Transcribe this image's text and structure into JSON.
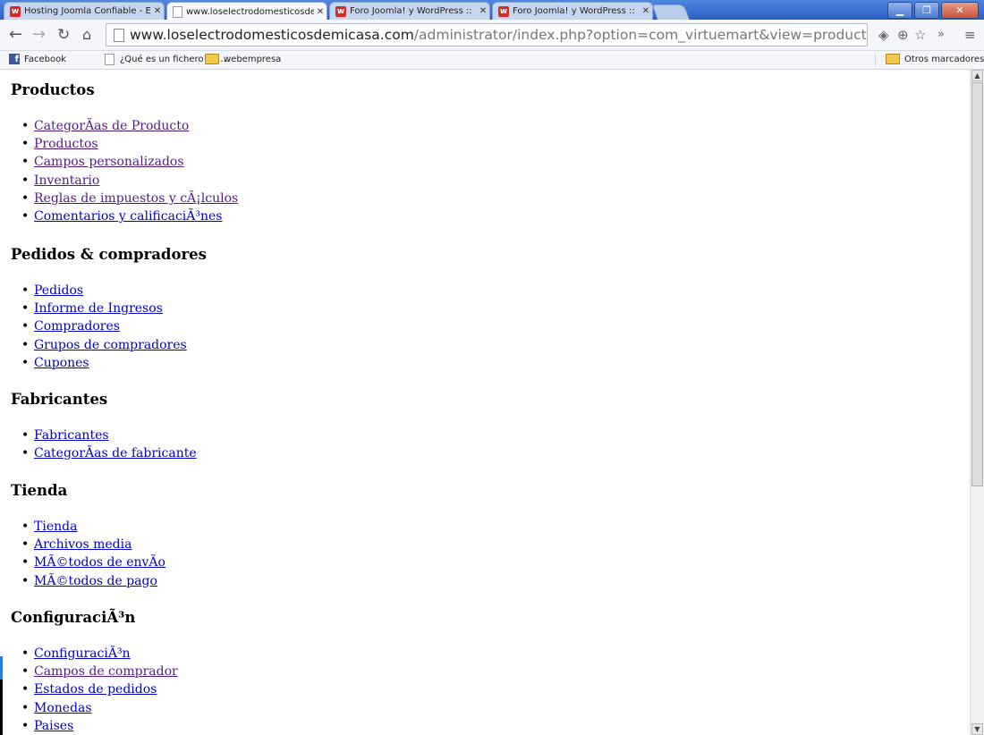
{
  "browser": {
    "tabs": [
      {
        "title": "Hosting Joomla Confiable - E",
        "icon": "webempresa-icon",
        "active": false
      },
      {
        "title": "www.loselectrodomesticosde",
        "icon": "page-icon",
        "active": true
      },
      {
        "title": "Foro Joomla! y WordPress ::",
        "icon": "webempresa-icon",
        "active": false
      },
      {
        "title": "Foro Joomla! y WordPress ::",
        "icon": "webempresa-icon",
        "active": false
      }
    ],
    "url_domain": "www.loselectrodomesticosdemicasa.com",
    "url_path": "/administrator/index.php?option=com_virtuemart&view=product",
    "bookmarks": [
      {
        "label": "Facebook",
        "icon": "facebook-icon"
      },
      {
        "label": "¿Qué es un fichero de ...",
        "icon": "page-icon"
      },
      {
        "label": "webempresa",
        "icon": "folder-icon"
      }
    ],
    "other_bookmarks": "Otros marcadores"
  },
  "sections": [
    {
      "title": "Productos",
      "links": [
        {
          "label": "CategorÃas de Producto",
          "visited": true
        },
        {
          "label": "Productos",
          "visited": true
        },
        {
          "label": "Campos personalizados",
          "visited": true
        },
        {
          "label": "Inventario",
          "visited": true
        },
        {
          "label": "Reglas de impuestos y cÃ¡lculos",
          "visited": true
        },
        {
          "label": "Comentarios y calificaciÃ³nes",
          "visited": false
        }
      ]
    },
    {
      "title": "Pedidos & compradores",
      "links": [
        {
          "label": "Pedidos",
          "visited": false
        },
        {
          "label": "Informe de Ingresos",
          "visited": false
        },
        {
          "label": "Compradores",
          "visited": false
        },
        {
          "label": "Grupos de compradores",
          "visited": false
        },
        {
          "label": "Cupones",
          "visited": false
        }
      ]
    },
    {
      "title": "Fabricantes",
      "links": [
        {
          "label": "Fabricantes",
          "visited": false
        },
        {
          "label": "CategorÃas de fabricante",
          "visited": false
        }
      ]
    },
    {
      "title": "Tienda",
      "links": [
        {
          "label": "Tienda",
          "visited": false
        },
        {
          "label": "Archivos media",
          "visited": false
        },
        {
          "label": "MÃ©todos de envÃo",
          "visited": false
        },
        {
          "label": "MÃ©todos de pago",
          "visited": false
        }
      ]
    },
    {
      "title": "ConfiguraciÃ³n",
      "links": [
        {
          "label": "ConfiguraciÃ³n",
          "visited": false
        },
        {
          "label": "Campos de comprador",
          "visited": true
        },
        {
          "label": "Estados de pedidos",
          "visited": false
        },
        {
          "label": "Monedas",
          "visited": false
        },
        {
          "label": "Paises",
          "visited": false
        }
      ]
    }
  ],
  "colors": {
    "link": "#0000cc",
    "visited_link": "#551a8b",
    "titlebar": "#2a5fc4"
  }
}
